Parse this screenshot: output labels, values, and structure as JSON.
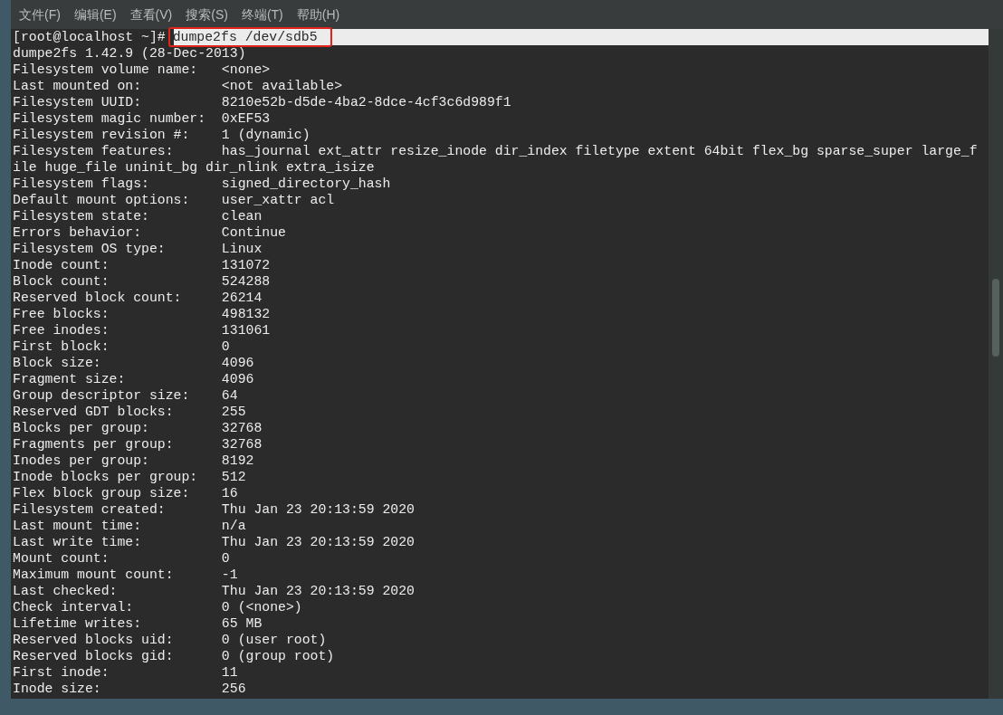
{
  "menu": [
    {
      "label": "文件(F)"
    },
    {
      "label": "编辑(E)"
    },
    {
      "label": "查看(V)"
    },
    {
      "label": "搜索(S)"
    },
    {
      "label": "终端(T)"
    },
    {
      "label": "帮助(H)"
    }
  ],
  "prompt": "[root@localhost ~]#",
  "command": {
    "text": "dumpe2fs /dev/sdb5",
    "selected": true,
    "annotated": true
  },
  "output": [
    "dumpe2fs 1.42.9 (28-Dec-2013)",
    "Filesystem volume name:   <none>",
    "Last mounted on:          <not available>",
    "Filesystem UUID:          8210e52b-d5de-4ba2-8dce-4cf3c6d989f1",
    "Filesystem magic number:  0xEF53",
    "Filesystem revision #:    1 (dynamic)",
    "Filesystem features:      has_journal ext_attr resize_inode dir_index filetype extent 64bit flex_bg sparse_super large_f",
    "ile huge_file uninit_bg dir_nlink extra_isize",
    "Filesystem flags:         signed_directory_hash",
    "Default mount options:    user_xattr acl",
    "Filesystem state:         clean",
    "Errors behavior:          Continue",
    "Filesystem OS type:       Linux",
    "Inode count:              131072",
    "Block count:              524288",
    "Reserved block count:     26214",
    "Free blocks:              498132",
    "Free inodes:              131061",
    "First block:              0",
    "Block size:               4096",
    "Fragment size:            4096",
    "Group descriptor size:    64",
    "Reserved GDT blocks:      255",
    "Blocks per group:         32768",
    "Fragments per group:      32768",
    "Inodes per group:         8192",
    "Inode blocks per group:   512",
    "Flex block group size:    16",
    "Filesystem created:       Thu Jan 23 20:13:59 2020",
    "Last mount time:          n/a",
    "Last write time:          Thu Jan 23 20:13:59 2020",
    "Mount count:              0",
    "Maximum mount count:      -1",
    "Last checked:             Thu Jan 23 20:13:59 2020",
    "Check interval:           0 (<none>)",
    "Lifetime writes:          65 MB",
    "Reserved blocks uid:      0 (user root)",
    "Reserved blocks gid:      0 (group root)",
    "First inode:              11",
    "Inode size:               256"
  ]
}
